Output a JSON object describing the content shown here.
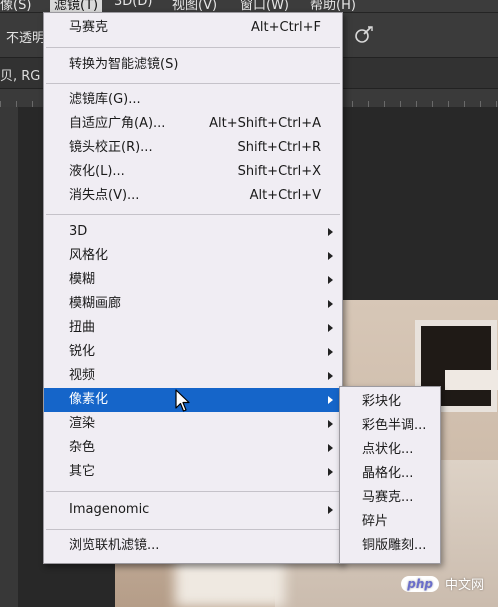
{
  "menubar": {
    "items": [
      {
        "label": "像(S)"
      },
      {
        "label": "滤镜(T)"
      },
      {
        "label": "3D(D)"
      },
      {
        "label": "视图(V)"
      },
      {
        "label": "窗口(W)"
      },
      {
        "label": "帮助(H)"
      }
    ]
  },
  "options_bar": {
    "opacity_label": "不透明"
  },
  "doc_info": {
    "tab_text": "贝, RG"
  },
  "filter_menu": {
    "last_filter": {
      "label": "马赛克",
      "shortcut": "Alt+Ctrl+F"
    },
    "convert_smart": {
      "label": "转换为智能滤镜(S)"
    },
    "gallery": {
      "label": "滤镜库(G)..."
    },
    "adaptive_wide_angle": {
      "label": "自适应广角(A)...",
      "shortcut": "Alt+Shift+Ctrl+A"
    },
    "lens_correction": {
      "label": "镜头校正(R)...",
      "shortcut": "Shift+Ctrl+R"
    },
    "liquify": {
      "label": "液化(L)...",
      "shortcut": "Shift+Ctrl+X"
    },
    "vanishing_point": {
      "label": "消失点(V)...",
      "shortcut": "Alt+Ctrl+V"
    },
    "groups": [
      {
        "label": "3D"
      },
      {
        "label": "风格化"
      },
      {
        "label": "模糊"
      },
      {
        "label": "模糊画廊"
      },
      {
        "label": "扭曲"
      },
      {
        "label": "锐化"
      },
      {
        "label": "视频"
      },
      {
        "label": "像素化"
      },
      {
        "label": "渲染"
      },
      {
        "label": "杂色"
      },
      {
        "label": "其它"
      }
    ],
    "imagenomic": {
      "label": "Imagenomic"
    },
    "browse_online": {
      "label": "浏览联机滤镜..."
    }
  },
  "pixelate_submenu": {
    "items": [
      {
        "label": "彩块化"
      },
      {
        "label": "彩色半调..."
      },
      {
        "label": "点状化..."
      },
      {
        "label": "晶格化..."
      },
      {
        "label": "马赛克..."
      },
      {
        "label": "碎片"
      },
      {
        "label": "铜版雕刻..."
      }
    ]
  },
  "watermark": {
    "logo": "php",
    "text": "中文网"
  },
  "colors": {
    "highlight": "#1565c9",
    "menu_bg": "#f0edf3"
  }
}
